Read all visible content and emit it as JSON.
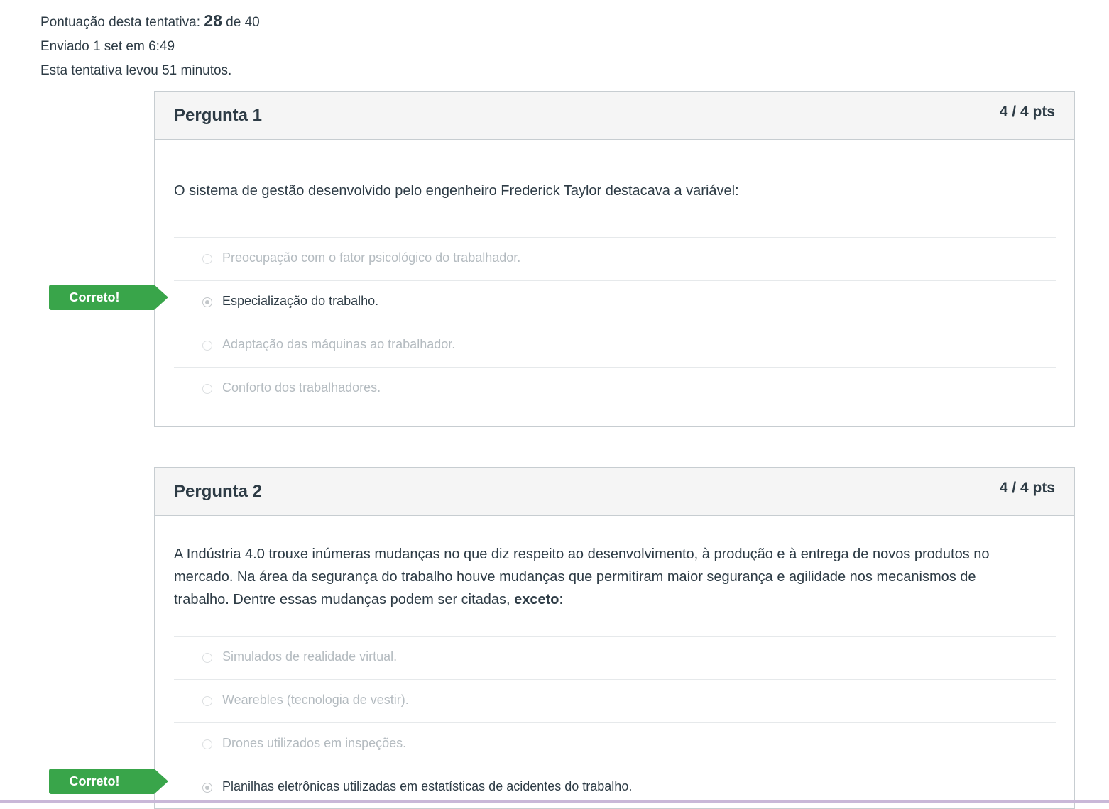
{
  "summary": {
    "score_label": "Pontuação desta tentativa:",
    "score_value": "28",
    "score_of": "de 40",
    "submitted": "Enviado 1 set em 6:49",
    "duration": "Esta tentativa levou 51 minutos."
  },
  "questions": [
    {
      "title": "Pergunta 1",
      "points": "4 / 4 pts",
      "text": "O sistema de gestão desenvolvido pelo engenheiro Frederick Taylor destacava a variável:",
      "answers": [
        {
          "text": "Preocupação com o fator psicológico do trabalhador.",
          "selected": false
        },
        {
          "text": "Especialização do trabalho.",
          "selected": true
        },
        {
          "text": "Adaptação das máquinas ao trabalhador.",
          "selected": false
        },
        {
          "text": "Conforto dos trabalhadores.",
          "selected": false
        }
      ],
      "flag": "Correto!"
    },
    {
      "title": "Pergunta 2",
      "points": "4 / 4 pts",
      "text_part1": "A Indústria 4.0 trouxe inúmeras mudanças no que diz respeito ao desenvolvimento, à produção e à entrega de novos produtos no mercado. Na área da segurança do trabalho houve mudanças que permitiram maior segurança e agilidade nos mecanismos de trabalho. Dentre essas mudanças podem ser citadas,",
      "text_bold": "exceto",
      "text_end": ":",
      "answers": [
        {
          "text": "Simulados de realidade virtual.",
          "selected": false
        },
        {
          "text": "Wearebles (tecnologia de vestir).",
          "selected": false
        },
        {
          "text": "Drones utilizados em inspeções.",
          "selected": false
        },
        {
          "text": "Planilhas eletrônicas utilizadas em estatísticas de acidentes do trabalho.",
          "selected": true
        }
      ],
      "flag": "Correto!"
    }
  ]
}
